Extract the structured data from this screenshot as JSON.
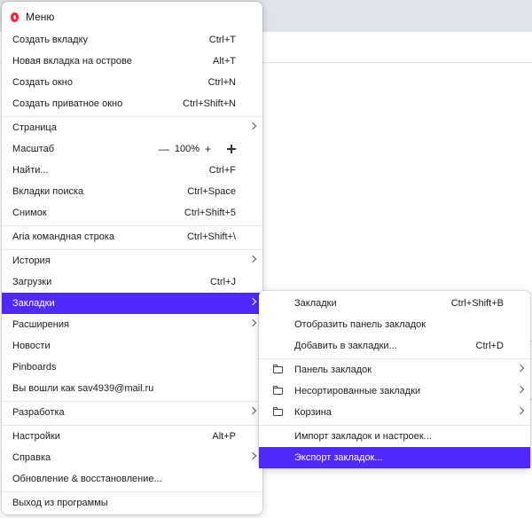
{
  "menu": {
    "header": "Меню",
    "items": [
      {
        "label": "Создать вкладку",
        "shortcut": "Ctrl+T"
      },
      {
        "label": "Новая вкладка на острове",
        "shortcut": "Alt+T"
      },
      {
        "label": "Создать окно",
        "shortcut": "Ctrl+N"
      },
      {
        "label": "Создать приватное окно",
        "shortcut": "Ctrl+Shift+N"
      },
      {
        "label": "Страница"
      },
      {
        "label": "Масштаб",
        "zoom_minus": "—",
        "zoom_value": "100%",
        "zoom_plus": "+"
      },
      {
        "label": "Найти...",
        "shortcut": "Ctrl+F"
      },
      {
        "label": "Вкладки поиска",
        "shortcut": "Ctrl+Space"
      },
      {
        "label": "Снимок",
        "shortcut": "Ctrl+Shift+5"
      },
      {
        "label": "Aria командная строка",
        "shortcut": "Ctrl+Shift+\\"
      },
      {
        "label": "История"
      },
      {
        "label": "Загрузки",
        "shortcut": "Ctrl+J"
      },
      {
        "label": "Закладки"
      },
      {
        "label": "Расширения"
      },
      {
        "label": "Новости"
      },
      {
        "label": "Pinboards"
      },
      {
        "label": "Вы вошли как sav4939@mail.ru"
      },
      {
        "label": "Разработка"
      },
      {
        "label": "Настройки",
        "shortcut": "Alt+P"
      },
      {
        "label": "Справка"
      },
      {
        "label": "Обновление & восстановление..."
      },
      {
        "label": "Выход из программы"
      }
    ]
  },
  "submenu": {
    "items": [
      {
        "label": "Закладки",
        "shortcut": "Ctrl+Shift+B"
      },
      {
        "label": "Отобразить панель закладок"
      },
      {
        "label": "Добавить в закладки...",
        "shortcut": "Ctrl+D"
      },
      {
        "label": "Панель закладок"
      },
      {
        "label": "Несортированные закладки"
      },
      {
        "label": "Корзина"
      },
      {
        "label": "Импорт закладок и настроек..."
      },
      {
        "label": "Экспорт закладок..."
      }
    ]
  },
  "colors": {
    "accent": "#5129ff",
    "opera_red": "#ff1b2d"
  }
}
